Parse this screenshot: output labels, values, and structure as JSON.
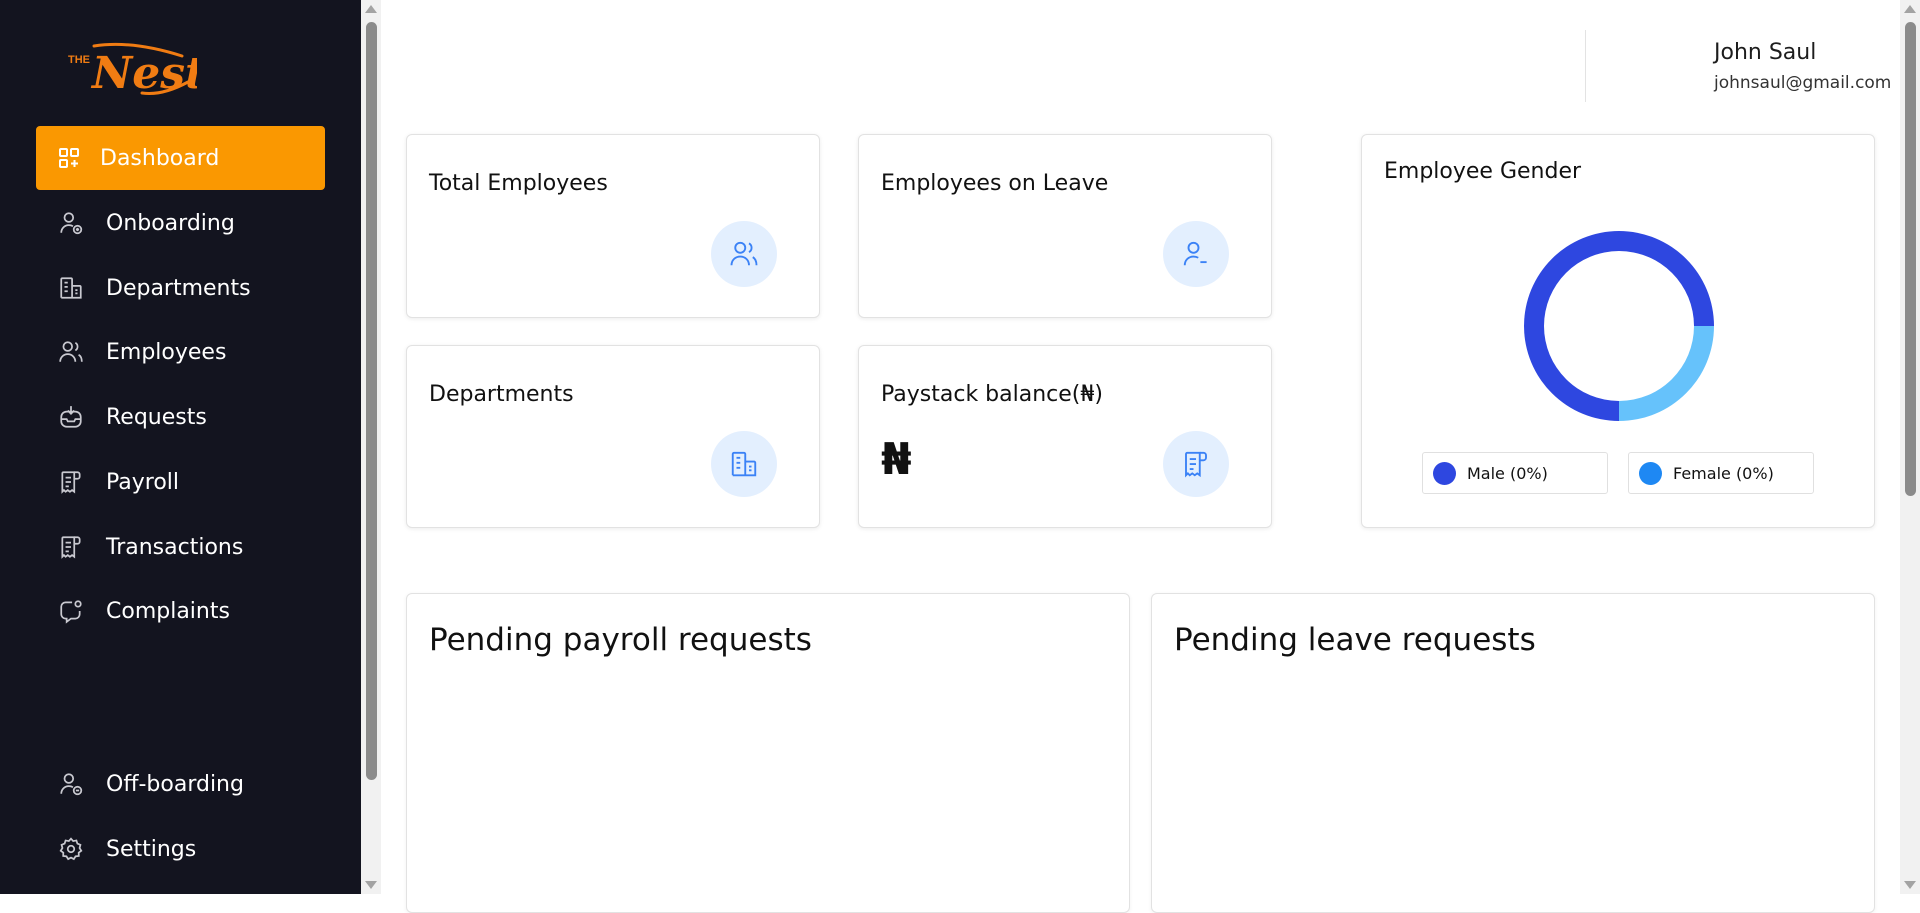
{
  "brand": {
    "logo_small": "THE",
    "logo_main": "Nest",
    "accent": "#fa9801",
    "sidebar_bg": "#13141f"
  },
  "sidebar": {
    "items": [
      {
        "label": "Dashboard",
        "icon": "grid-plus-icon",
        "active": true
      },
      {
        "label": "Onboarding",
        "icon": "user-add-icon"
      },
      {
        "label": "Departments",
        "icon": "building-icon"
      },
      {
        "label": "Employees",
        "icon": "users-icon"
      },
      {
        "label": "Requests",
        "icon": "inbox-icon"
      },
      {
        "label": "Payroll",
        "icon": "receipt-icon"
      },
      {
        "label": "Transactions",
        "icon": "receipt-icon"
      },
      {
        "label": "Complaints",
        "icon": "chat-alert-icon"
      }
    ],
    "bottom_items": [
      {
        "label": "Off-boarding",
        "icon": "user-remove-icon"
      },
      {
        "label": "Settings",
        "icon": "gear-icon"
      }
    ]
  },
  "header": {
    "user_name": "John Saul",
    "user_email": "johnsaul@gmail.com"
  },
  "stats": {
    "total_employees": {
      "title": "Total Employees",
      "icon": "users-icon"
    },
    "employees_on_leave": {
      "title": "Employees on Leave",
      "icon": "user-minus-icon"
    },
    "departments": {
      "title": "Departments",
      "icon": "building-icon"
    },
    "paystack_balance": {
      "title": "Paystack balance(₦)",
      "value": "₦",
      "icon": "receipt-icon"
    }
  },
  "gender_chart": {
    "title": "Employee Gender",
    "legend": [
      {
        "label": "Male (0%)",
        "color": "#2e47e0"
      },
      {
        "label": "Female (0%)",
        "color": "#1e88f3"
      }
    ]
  },
  "chart_data": {
    "type": "pie",
    "title": "Employee Gender",
    "categories": [
      "Male (0%)",
      "Female (0%)"
    ],
    "values": [
      75,
      25
    ],
    "colors": [
      "#2e47e0",
      "#66c2fb"
    ]
  },
  "panels": {
    "payroll_title": "Pending payroll requests",
    "leave_title": "Pending leave requests"
  }
}
